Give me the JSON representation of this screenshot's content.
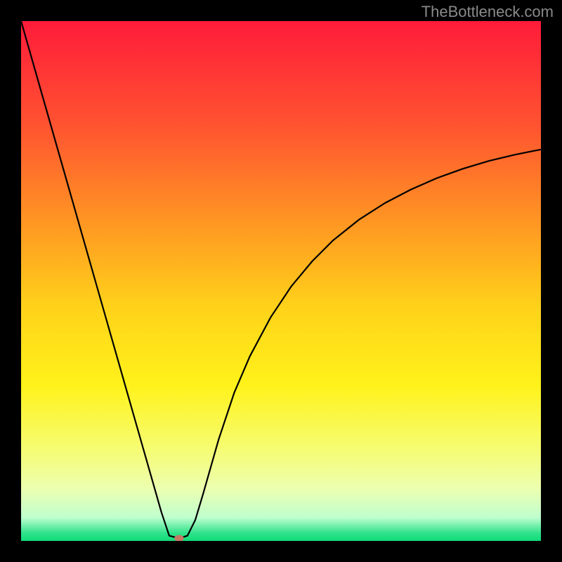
{
  "watermark": "TheBottleneck.com",
  "chart_data": {
    "type": "line",
    "title": "",
    "xlabel": "",
    "ylabel": "",
    "xlim": [
      0,
      100
    ],
    "ylim": [
      0,
      100
    ],
    "grid": false,
    "background_gradient": {
      "stops": [
        {
          "pos": 0.0,
          "color": "#ff1b3a"
        },
        {
          "pos": 0.2,
          "color": "#ff5330"
        },
        {
          "pos": 0.4,
          "color": "#ff9b22"
        },
        {
          "pos": 0.55,
          "color": "#ffd21a"
        },
        {
          "pos": 0.7,
          "color": "#fff21a"
        },
        {
          "pos": 0.82,
          "color": "#f6fc70"
        },
        {
          "pos": 0.9,
          "color": "#ecffb0"
        },
        {
          "pos": 0.955,
          "color": "#bfffcf"
        },
        {
          "pos": 0.985,
          "color": "#2fe28a"
        },
        {
          "pos": 1.0,
          "color": "#0edc78"
        }
      ]
    },
    "series": [
      {
        "name": "bottleneck-curve",
        "color": "#000000",
        "x": [
          0.0,
          3.0,
          6.0,
          9.0,
          12.0,
          15.0,
          18.0,
          21.0,
          24.0,
          27.0,
          28.5,
          30.4,
          32.0,
          33.5,
          35.0,
          38.0,
          41.0,
          44.0,
          48.0,
          52.0,
          56.0,
          60.0,
          65.0,
          70.0,
          75.0,
          80.0,
          85.0,
          90.0,
          95.0,
          100.0
        ],
        "y": [
          100.0,
          89.5,
          79.0,
          68.5,
          58.0,
          47.5,
          37.0,
          26.5,
          16.0,
          5.5,
          1.0,
          0.5,
          1.0,
          4.0,
          9.0,
          19.5,
          28.5,
          35.5,
          43.0,
          49.0,
          53.8,
          57.8,
          61.8,
          65.0,
          67.6,
          69.8,
          71.6,
          73.1,
          74.3,
          75.3
        ]
      }
    ],
    "marker": {
      "name": "min-point-marker",
      "x": 30.4,
      "y": 0.5,
      "rx": 0.9,
      "ry": 0.65,
      "color": "#c47a66"
    }
  }
}
